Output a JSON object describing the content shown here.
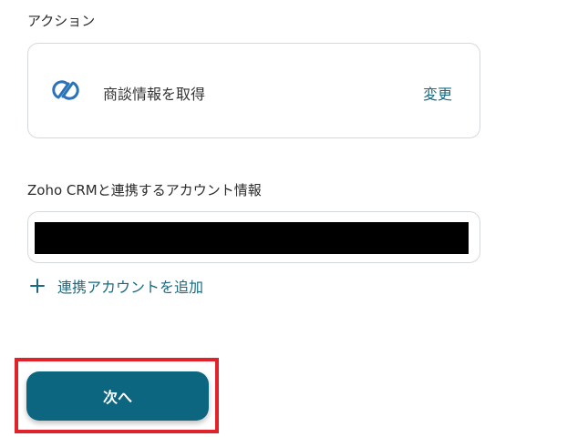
{
  "action_section": {
    "label": "アクション",
    "card": {
      "icon": "zoho-crm-icon",
      "name": "商談情報を取得",
      "change_label": "変更"
    }
  },
  "account_section": {
    "label": "Zoho CRMと連携するアカウント情報",
    "value": "",
    "add_account_label": "連携アカウントを追加"
  },
  "footer": {
    "next_label": "次へ"
  },
  "colors": {
    "accent": "#0d667f",
    "link": "#1a6a80",
    "highlight": "#e0232b",
    "border": "#d6d9dc"
  }
}
